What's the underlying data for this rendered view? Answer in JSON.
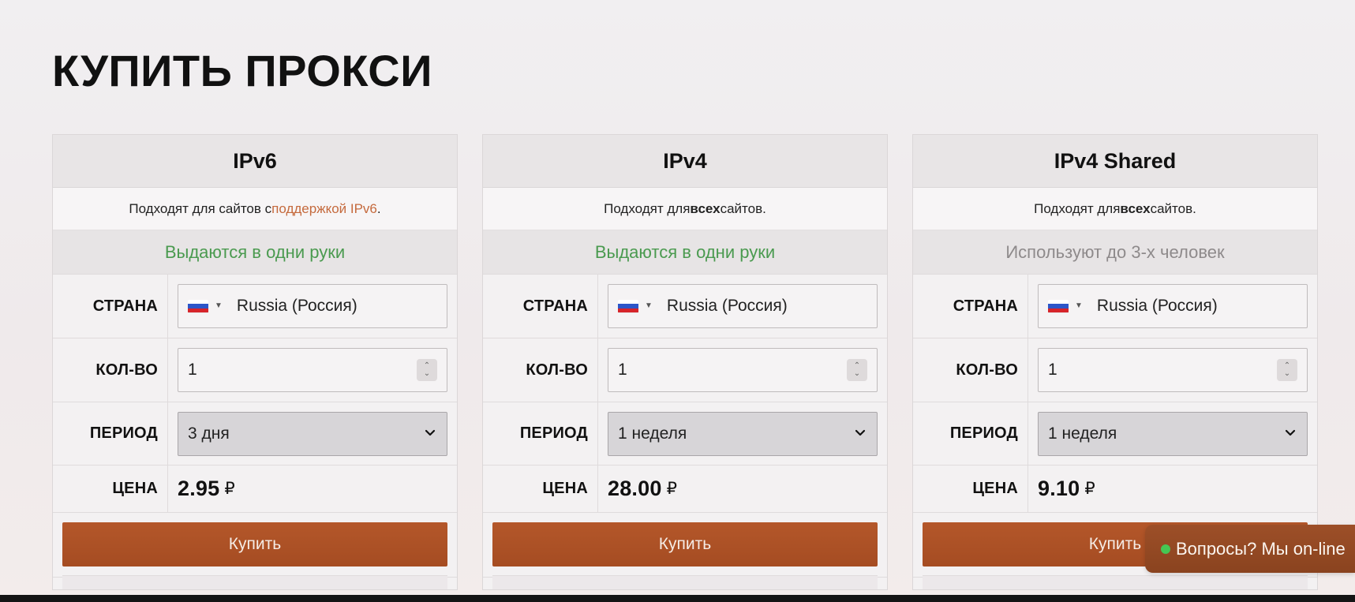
{
  "page": {
    "title": "КУПИТЬ ПРОКСИ"
  },
  "plans": [
    {
      "name": "IPv6",
      "note_prefix": "Подходят для сайтов с ",
      "note_link": "поддержкой IPv6",
      "note_suffix": ".",
      "badge": "Выдаются в одни руки",
      "badge_color": "#4a9a4f",
      "country_label": "СТРАНА",
      "country_value": "Russia (Россия)",
      "country_flag": "ru-flag-icon",
      "quantity_label": "КОЛ-ВО",
      "quantity_value": "1",
      "period_label": "ПЕРИОД",
      "period_value": "3 дня",
      "price_label": "ЦЕНА",
      "price_value": "2.95",
      "currency": "₽",
      "buy_label": "Купить"
    },
    {
      "name": "IPv4",
      "note_prefix": "Подходят для ",
      "note_bold": "всех",
      "note_suffix": " сайтов.",
      "badge": "Выдаются в одни руки",
      "badge_color": "#4a9a4f",
      "country_label": "СТРАНА",
      "country_value": "Russia (Россия)",
      "country_flag": "ru-flag-icon",
      "quantity_label": "КОЛ-ВО",
      "quantity_value": "1",
      "period_label": "ПЕРИОД",
      "period_value": "1 неделя",
      "price_label": "ЦЕНА",
      "price_value": "28.00",
      "currency": "₽",
      "buy_label": "Купить"
    },
    {
      "name": "IPv4 Shared",
      "note_prefix": "Подходят для ",
      "note_bold": "всех",
      "note_suffix": " сайтов.",
      "badge": "Используют до 3-х человек",
      "badge_color": "#8e8a8b",
      "country_label": "СТРАНА",
      "country_value": "Russia (Россия)",
      "country_flag": "ru-flag-icon",
      "quantity_label": "КОЛ-ВО",
      "quantity_value": "1",
      "period_label": "ПЕРИОД",
      "period_value": "1 неделя",
      "price_label": "ЦЕНА",
      "price_value": "9.10",
      "currency": "₽",
      "buy_label": "Купить"
    }
  ],
  "chat_widget": {
    "label": "Вопросы? Мы on-line",
    "status_color": "#45c653"
  },
  "colors": {
    "accent": "#ab5126",
    "link": "#c56a3d"
  }
}
